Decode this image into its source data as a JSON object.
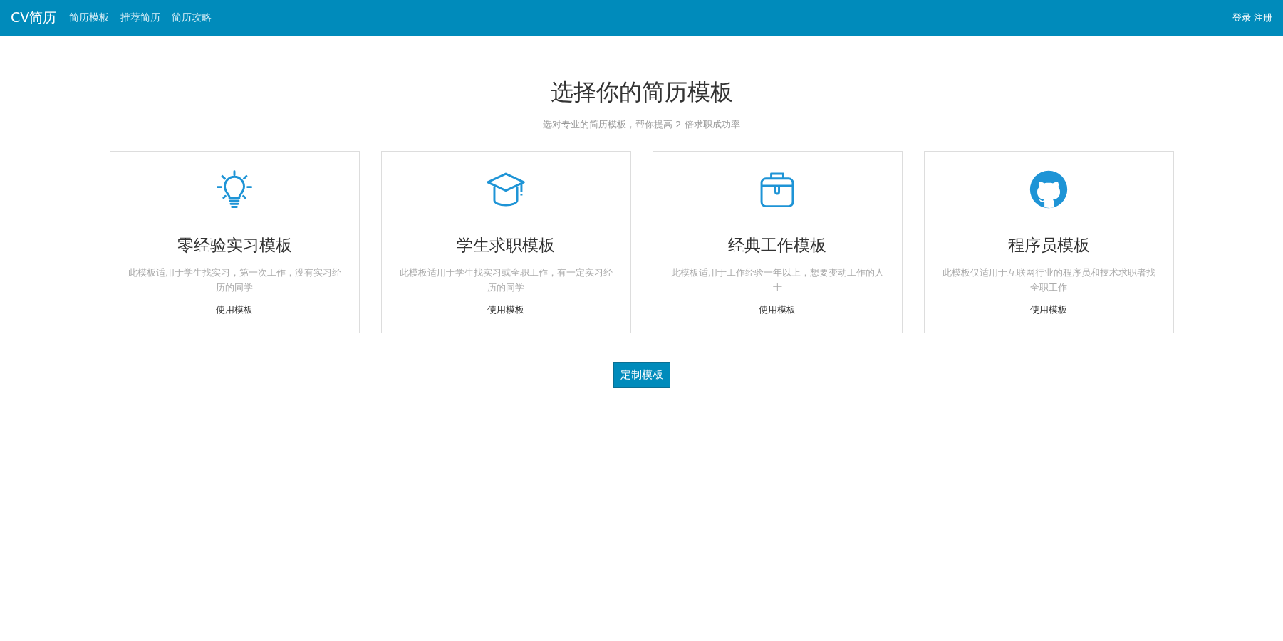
{
  "navbar": {
    "brand": "CV简历",
    "links": [
      "简历模板",
      "推荐简历",
      "简历攻略"
    ],
    "account": [
      "登录",
      "注册"
    ]
  },
  "header": {
    "title": "选择你的简历模板",
    "subtitle": "选对专业的简历模板，帮你提高 2 倍求职成功率"
  },
  "cards": [
    {
      "title": "零经验实习模板",
      "description": "此模板适用于学生找实习，第一次工作，没有实习经历的同学",
      "action": "使用模板"
    },
    {
      "title": "学生求职模板",
      "description": "此模板适用于学生找实习或全职工作，有一定实习经历的同学",
      "action": "使用模板"
    },
    {
      "title": "经典工作模板",
      "description": "此模板适用于工作经验一年以上，想要变动工作的人士",
      "action": "使用模板"
    },
    {
      "title": "程序员模板",
      "description": "此模板仅适用于互联网行业的程序员和技术求职者找全职工作",
      "action": "使用模板"
    }
  ],
  "custom_button": "定制模板"
}
